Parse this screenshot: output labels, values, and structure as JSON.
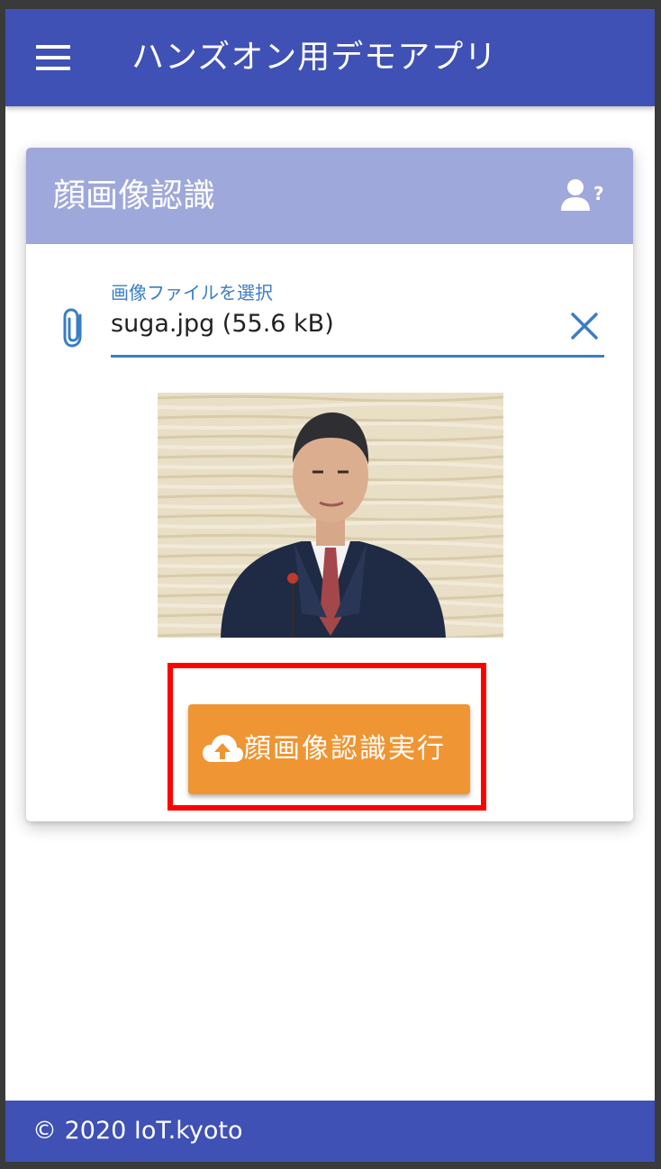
{
  "app": {
    "title": "ハンズオン用デモアプリ",
    "menu_icon": "hamburger-menu-icon"
  },
  "card": {
    "title": "顔画像認識",
    "help_icon": "person-question-icon",
    "file_field": {
      "label": "画像ファイルを選択",
      "value": "suga.jpg (55.6 kB)",
      "attach_icon": "paperclip-icon",
      "clear_icon": "close-icon"
    },
    "preview_image": "portrait-photo",
    "run_button": {
      "label": "顔画像認識実行",
      "icon": "cloud-upload-icon"
    }
  },
  "footer": {
    "text": "© 2020 IoT.kyoto"
  },
  "colors": {
    "primary": "#3f51b5",
    "card_header": "#9fa8da",
    "accent_orange": "#ef9533",
    "field_blue": "#3b7dc4",
    "highlight_red": "#ff0000"
  }
}
